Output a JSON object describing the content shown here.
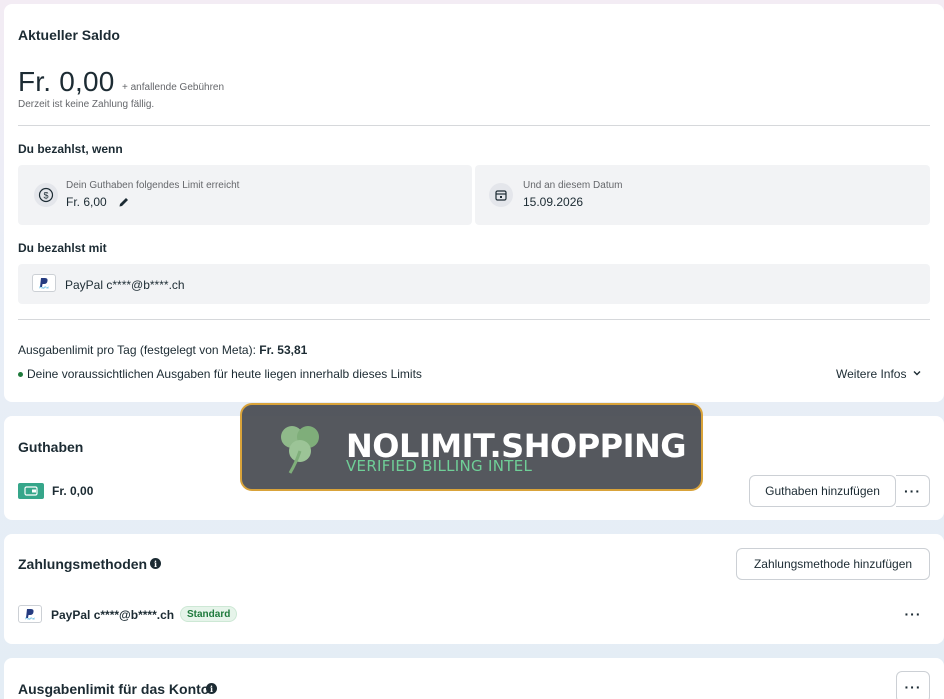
{
  "saldo": {
    "title": "Aktueller Saldo",
    "amount": "Fr. 0,00",
    "fee_note": "+ anfallende Gebühren",
    "status": "Derzeit ist keine Zahlung fällig.",
    "pay_when_title": "Du bezahlst, wenn",
    "limit_label": "Dein Guthaben folgendes Limit erreicht",
    "limit_value": "Fr. 6,00",
    "date_label": "Und an diesem Datum",
    "date_value": "15.09.2026",
    "pay_with_title": "Du bezahlst mit",
    "payment_method": "PayPal c****@b****.ch",
    "daily_limit_label": "Ausgabenlimit pro Tag (festgelegt von Meta):",
    "daily_limit_value": "Fr. 53,81",
    "forecast_note": "Deine voraussichtlichen Ausgaben für heute liegen innerhalb dieses Limits",
    "more_info": "Weitere Infos"
  },
  "guthaben": {
    "title": "Guthaben",
    "amount": "Fr. 0,00",
    "add_button": "Guthaben hinzufügen",
    "more_button": "···"
  },
  "zahlungsmethoden": {
    "title": "Zahlungsmethoden",
    "add_button": "Zahlungsmethode hinzufügen",
    "method": "PayPal c****@b****.ch",
    "badge": "Standard",
    "more_button": "···"
  },
  "konto_limit": {
    "title": "Ausgabenlimit für das Konto",
    "more_button": "···"
  },
  "watermark": {
    "title": "NOLIMIT.SHOPPING",
    "subtitle": "VERIFIED BILLING INTEL"
  },
  "icons": {
    "dollar": "dollar-circle-icon",
    "calendar": "calendar-icon",
    "edit": "pencil-icon",
    "paypal": "paypal-icon",
    "wallet": "wallet-icon",
    "chevron": "chevron-down-icon",
    "info": "info-icon",
    "clover": "clover-icon"
  },
  "colors": {
    "accent_green": "#1e7a3c",
    "wallet_teal": "#36a68a",
    "watermark_border": "#d9a33a"
  }
}
